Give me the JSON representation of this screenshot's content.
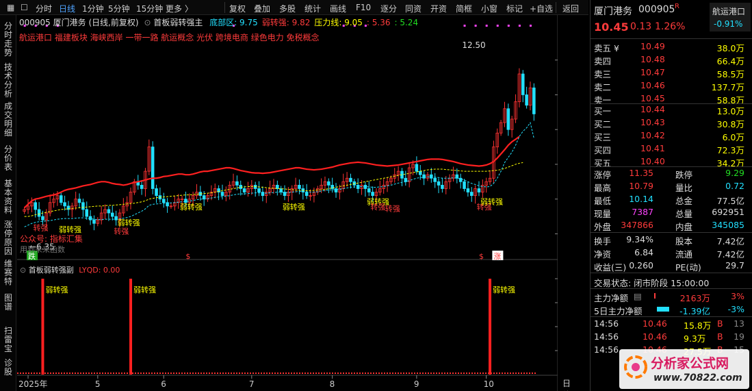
{
  "toolbar": {
    "left_items": [
      "分时",
      "日线",
      "1分钟",
      "5分钟",
      "15分钟",
      "更多"
    ],
    "right_items": [
      "复权",
      "叠加",
      "多股",
      "统计",
      "画线",
      "F10",
      "逐分",
      "同资",
      "开资",
      "简框",
      "小窗",
      "标记",
      "+自选",
      "返回"
    ],
    "active": "日线"
  },
  "sidebar": [
    "分时走势",
    "技术分析",
    "成交明细",
    "分价表",
    "基本资料",
    "涨停原因",
    "维赛特",
    "图谱",
    "扫雷宝",
    "诊股"
  ],
  "main_chart": {
    "header": "000905 厦门港务 (日线,前复权)",
    "indicator_name": "首板弱转强主",
    "indicators": [
      {
        "label": "底部区: 9.75",
        "color": "#22e0ff"
      },
      {
        "label": "弱转强: 9.82",
        "color": "#ff3b3b"
      },
      {
        "label": "压力线: 9.05",
        "color": "#ffff00"
      },
      {
        "label": ": 5.36",
        "color": "#ff3b3b"
      },
      {
        "label": ": 5.24",
        "color": "#22dd22"
      }
    ],
    "concepts": "航运港口 福建板块 海峡西岸 一带一路 航运概念 光伏 跨境电商 绿色电力 免税概念",
    "price_marks": [
      {
        "text": "12.50",
        "desc": "max"
      },
      {
        "text": "←6.35",
        "desc": "min"
      }
    ],
    "notes": [
      "公众号: 指标汇集",
      "用到未来函数"
    ],
    "badges": [
      "跌",
      "$",
      "$",
      "涨"
    ]
  },
  "sub_chart": {
    "header": "首板弱转强副",
    "value_label": "LYQD: 0.00"
  },
  "bottom_label": "日线",
  "chart_data": [
    {
      "type": "candlestick",
      "title": "",
      "xlabel": "",
      "ylabel": "",
      "x_ticks": [
        "2025年",
        "5",
        "6",
        "7",
        "8",
        "9",
        "10"
      ],
      "y_ticks": [
        7.0,
        8.0,
        9.0,
        10.0,
        11.0,
        12.0
      ],
      "ylim": [
        6.3,
        12.9
      ],
      "max_label": 12.5,
      "min_label": 6.35,
      "closes": [
        7.7,
        7.8,
        7.9,
        7.7,
        7.5,
        7.4,
        7.6,
        7.9,
        8.0,
        8.1,
        7.9,
        7.8,
        7.7,
        7.8,
        8.0,
        7.9,
        7.7,
        7.5,
        7.4,
        7.3,
        7.4,
        7.6,
        7.7,
        7.6,
        7.5,
        7.4,
        7.6,
        7.8,
        7.9,
        8.2,
        8.5,
        8.4,
        8.3,
        8.8,
        9.5,
        8.3,
        8.1,
        8.0,
        7.9,
        7.8,
        7.8,
        7.9,
        8.0,
        8.0,
        7.9,
        8.0,
        8.1,
        8.2,
        8.1,
        8.0,
        8.1,
        8.2,
        8.3,
        8.2,
        8.1,
        8.2,
        8.4,
        8.5,
        8.4,
        8.3,
        8.2,
        8.3,
        8.4,
        8.3,
        8.2,
        8.1,
        8.2,
        8.3,
        8.4,
        8.3,
        8.2,
        8.1,
        8.2,
        8.3,
        8.4,
        8.3,
        8.2,
        8.1,
        8.1,
        8.2,
        8.3,
        8.4,
        8.5,
        8.4,
        8.3,
        8.2,
        8.3,
        8.5,
        8.6,
        8.5,
        8.4,
        8.3,
        8.4,
        8.3,
        8.2,
        8.1,
        8.2,
        8.3,
        8.4,
        8.5,
        8.6,
        8.7,
        8.8,
        8.6,
        8.5,
        8.9,
        9.0,
        8.8,
        8.7,
        8.6,
        8.7,
        8.6,
        8.5,
        8.4,
        8.3,
        8.5,
        8.6,
        8.7,
        8.6,
        8.5,
        8.3,
        8.2,
        8.1,
        8.3,
        8.2,
        8.4,
        8.5,
        8.6,
        9.5,
        9.9,
        10.2,
        10.6,
        10.0,
        10.3,
        10.8,
        11.6,
        11.0,
        10.7,
        11.2,
        10.45
      ],
      "series": [
        {
          "name": "弱转强",
          "color": "#ff2020",
          "values": [
            7.75,
            7.85,
            7.95,
            8.0,
            8.02,
            8.05,
            8.08,
            8.1,
            8.12,
            8.15,
            8.2,
            8.25,
            8.28,
            8.3,
            8.32,
            8.35,
            8.38,
            8.4,
            8.42,
            8.45,
            8.48,
            8.5,
            8.5,
            8.48,
            8.45,
            8.43,
            8.42,
            8.4,
            8.42,
            8.45,
            8.48,
            8.5,
            8.52,
            8.55,
            8.58,
            8.6,
            8.6,
            8.62,
            8.65,
            8.66,
            8.68,
            8.7,
            8.72,
            8.72,
            8.7,
            8.7,
            8.72,
            8.75,
            8.78,
            8.8,
            8.8,
            8.82,
            8.84,
            8.86,
            8.88,
            8.9,
            8.9,
            8.88,
            8.85,
            8.82,
            8.8,
            8.78,
            8.76,
            8.75,
            8.75,
            8.74,
            8.75,
            8.76,
            8.78,
            8.8,
            8.82,
            8.84,
            8.86,
            8.88,
            8.9,
            8.9,
            8.88,
            8.86,
            8.85,
            8.84,
            8.85,
            8.86,
            8.88,
            8.9,
            8.92,
            8.95,
            8.98,
            9.0,
            9.02,
            9.04,
            9.05,
            9.06,
            9.05,
            9.04,
            9.02,
            9.0,
            8.98,
            8.97,
            8.96,
            8.95,
            8.96,
            8.97,
            8.98,
            9.0,
            9.02,
            9.04,
            9.06,
            9.08,
            9.1,
            9.12,
            9.14,
            9.15,
            9.15,
            9.15,
            9.14,
            9.12,
            9.1,
            9.08,
            9.05,
            9.02,
            9.0,
            8.98,
            8.97,
            8.96,
            8.95,
            8.96,
            8.98,
            9.02,
            9.08,
            9.18,
            9.3,
            9.42,
            9.55,
            9.65,
            9.72,
            9.8
          ]
        },
        {
          "name": "压力线",
          "color": "#ffff00",
          "values": [
            7.5,
            7.5,
            7.52,
            7.55,
            7.57,
            7.6,
            7.62,
            7.64,
            7.66,
            7.68,
            7.7,
            7.71,
            7.72,
            7.73,
            7.74,
            7.75,
            7.76,
            7.77,
            7.78,
            7.79,
            7.8,
            7.8,
            7.81,
            7.82,
            7.82,
            7.83,
            7.84,
            7.85,
            7.86,
            7.87,
            7.88,
            7.9,
            7.92,
            7.95,
            8.0,
            8.02,
            8.04,
            8.05,
            8.06,
            8.07,
            8.08,
            8.09,
            8.1,
            8.11,
            8.12,
            8.12,
            8.13,
            8.14,
            8.15,
            8.16,
            8.17,
            8.18,
            8.2,
            8.22,
            8.24,
            8.26,
            8.28,
            8.3,
            8.32,
            8.34,
            8.35,
            8.36,
            8.36,
            8.36,
            8.35,
            8.34,
            8.33,
            8.32,
            8.31,
            8.3,
            8.3,
            8.29,
            8.28,
            8.27,
            8.26,
            8.25,
            8.25,
            8.24,
            8.24,
            8.25,
            8.26,
            8.27,
            8.28,
            8.3,
            8.32,
            8.34,
            8.36,
            8.38,
            8.4,
            8.42,
            8.44,
            8.46,
            8.48,
            8.5,
            8.52,
            8.54,
            8.56,
            8.58,
            8.6,
            8.62,
            8.64,
            8.66,
            8.68,
            8.7,
            8.72,
            8.74,
            8.76,
            8.78,
            8.8,
            8.82,
            8.84,
            8.85,
            8.86,
            8.86,
            8.86,
            8.85,
            8.84,
            8.83,
            8.82,
            8.81,
            8.8,
            8.8,
            8.8,
            8.8,
            8.8,
            8.8,
            8.8,
            8.81,
            8.82,
            8.83,
            8.85,
            8.88,
            8.92,
            8.96,
            9.0,
            9.03,
            9.05
          ]
        },
        {
          "name": "底部区",
          "color": "#22e0ff",
          "values": [
            7.2,
            7.25,
            7.3,
            7.33,
            7.35,
            7.36,
            7.37,
            7.38,
            7.4,
            7.42,
            7.43,
            7.44,
            7.44,
            7.44,
            7.45,
            7.46,
            7.46,
            7.45,
            7.44,
            7.42,
            7.41,
            7.41,
            7.42,
            7.42,
            7.42,
            7.42,
            7.43,
            7.45,
            7.47,
            7.5,
            7.55,
            7.6,
            7.65,
            7.72,
            7.82,
            7.85,
            7.86,
            7.87,
            7.88,
            7.88,
            7.89,
            7.9,
            7.91,
            7.92,
            7.93,
            7.94,
            7.96,
            7.98,
            8.0,
            8.0,
            8.01,
            8.03,
            8.05,
            8.06,
            8.07,
            8.08,
            8.1,
            8.12,
            8.14,
            8.15,
            8.15,
            8.16,
            8.17,
            8.18,
            8.18,
            8.17,
            8.17,
            8.18,
            8.19,
            8.2,
            8.2,
            8.19,
            8.19,
            8.2,
            8.21,
            8.22,
            8.22,
            8.21,
            8.2,
            8.2,
            8.21,
            8.23,
            8.25,
            8.26,
            8.27,
            8.27,
            8.28,
            8.3,
            8.32,
            8.34,
            8.35,
            8.35,
            8.36,
            8.36,
            8.35,
            8.34,
            8.34,
            8.35,
            8.36,
            8.38,
            8.4,
            8.43,
            8.46,
            8.48,
            8.5,
            8.53,
            8.57,
            8.6,
            8.62,
            8.63,
            8.64,
            8.64,
            8.63,
            8.62,
            8.6,
            8.6,
            8.6,
            8.61,
            8.6,
            8.58,
            8.55,
            8.5,
            8.45,
            8.42,
            8.38,
            8.36,
            8.35,
            8.36,
            8.45,
            8.6,
            8.8,
            9.05,
            9.2,
            9.35,
            9.55,
            9.8,
            9.95,
            10.05,
            10.2,
            9.75
          ]
        }
      ],
      "labels": [
        {
          "text": "弱转强",
          "color": "#ffff00"
        },
        {
          "text": "转强",
          "color": "#ff3b3b"
        }
      ]
    },
    {
      "type": "bar",
      "title": "",
      "y_ticks": [
        5.0,
        10.0,
        15.0,
        20.0
      ],
      "ylim": [
        0,
        21
      ],
      "bars": [
        {
          "index": 5,
          "value": 20
        },
        {
          "index": 29,
          "value": 20
        },
        {
          "index": 127,
          "value": 20
        }
      ],
      "bar_label": "弱转强"
    }
  ],
  "quote": {
    "name": "厦门港务",
    "code": "000905",
    "sector": "航运港口",
    "sector_change": "-0.91%",
    "price": "10.45",
    "change": "0.13",
    "change_pct": "1.26%",
    "asks": [
      {
        "label": "卖五 ¥",
        "price": "10.49",
        "vol": "38.0万"
      },
      {
        "label": "卖四",
        "price": "10.48",
        "vol": "66.4万"
      },
      {
        "label": "卖三",
        "price": "10.47",
        "vol": "58.5万"
      },
      {
        "label": "卖二",
        "price": "10.46",
        "vol": "137.7万"
      },
      {
        "label": "卖一",
        "price": "10.45",
        "vol": "58.8万"
      }
    ],
    "bids": [
      {
        "label": "买一",
        "price": "10.44",
        "vol": "13.0万"
      },
      {
        "label": "买二",
        "price": "10.43",
        "vol": "30.8万"
      },
      {
        "label": "买三",
        "price": "10.42",
        "vol": "6.0万"
      },
      {
        "label": "买四",
        "price": "10.41",
        "vol": "72.3万"
      },
      {
        "label": "买五",
        "price": "10.40",
        "vol": "34.2万"
      }
    ],
    "stats": [
      {
        "l1": "涨停",
        "v1": "11.35",
        "c1": "red",
        "l2": "跌停",
        "v2": "9.29",
        "c2": "green"
      },
      {
        "l1": "最高",
        "v1": "10.79",
        "c1": "red",
        "l2": "量比",
        "v2": "0.72",
        "c2": "cyan"
      },
      {
        "l1": "最低",
        "v1": "10.14",
        "c1": "cyan",
        "l2": "总金",
        "v2": "77.5亿",
        "c2": "wh"
      },
      {
        "l1": "现量",
        "v1": "7387",
        "c1": "mag",
        "l2": "总量",
        "v2": "692951",
        "c2": "wh"
      },
      {
        "l1": "外盘",
        "v1": "347866",
        "c1": "red",
        "l2": "内盘",
        "v2": "345085",
        "c2": "cyan"
      }
    ],
    "stats2": [
      {
        "l1": "换手",
        "v1": "9.34%",
        "l2": "股本",
        "v2": "7.42亿"
      },
      {
        "l1": "净资",
        "v1": "6.84",
        "l2": "流通",
        "v2": "7.42亿"
      },
      {
        "l1": "收益(三)",
        "v1": "0.260",
        "l2": "PE(动)",
        "v2": "29.7"
      }
    ],
    "trade_status": "交易状态: 闭市阶段 15:00:00",
    "main_flow": {
      "label": "主力净额",
      "value": "2163万",
      "pct": "3%"
    },
    "flow5": {
      "label": "5日主力净额",
      "value": "-1.39亿",
      "pct": "-3%"
    },
    "ticks": [
      {
        "time": "14:56",
        "price": "10.46",
        "vol": "15.8万",
        "side": "B",
        "n": "13"
      },
      {
        "time": "14:56",
        "price": "10.46",
        "vol": "9.3万",
        "side": "B",
        "n": "19"
      },
      {
        "time": "14:56",
        "price": "10.46",
        "vol": "27.5万",
        "side": "B",
        "n": "15"
      }
    ]
  },
  "watermark": {
    "title": "分析家公式网",
    "url": "www.70822.com"
  }
}
